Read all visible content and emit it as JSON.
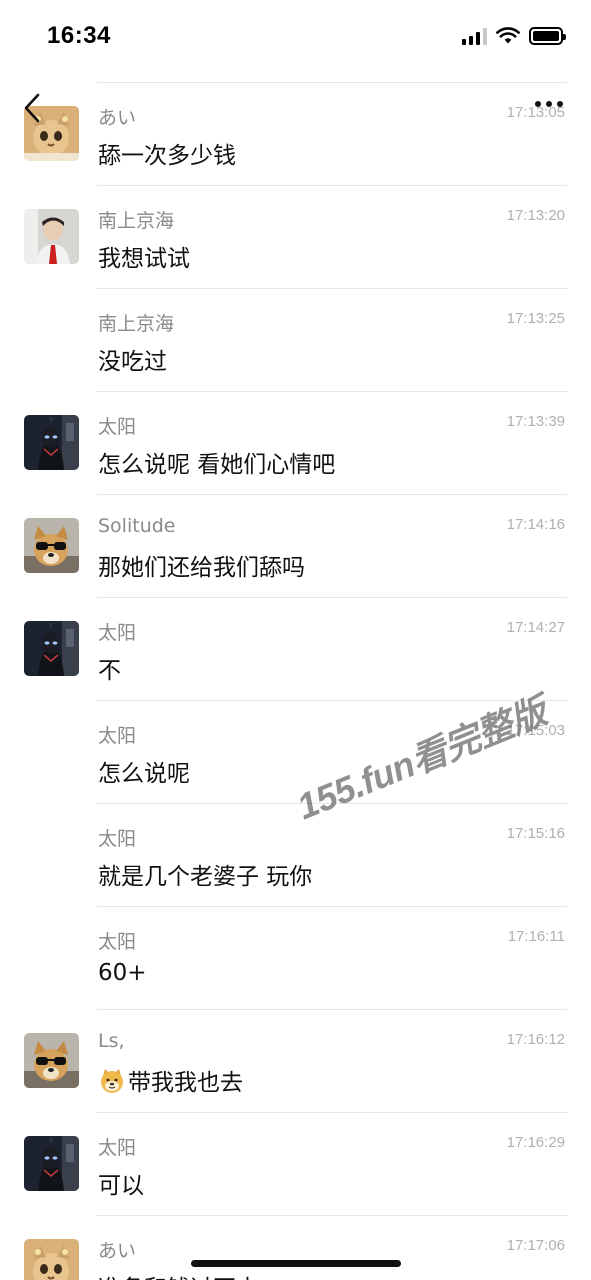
{
  "status_bar": {
    "time": "16:34",
    "icons": [
      "signal-icon",
      "wifi-icon",
      "battery-icon"
    ]
  },
  "header": {
    "back_icon": "chevron-left-icon",
    "more_icon": "more-dots-icon"
  },
  "messages": [
    {
      "sender": "あい",
      "time": "17:13:05",
      "text": "舔一次多少钱",
      "avatar": "cat-avatar"
    },
    {
      "sender": "南上京海",
      "time": "17:13:20",
      "text": "我想试试",
      "avatar": "person-avatar"
    },
    {
      "sender": "南上京海",
      "time": "17:13:25",
      "text": "没吃过",
      "avatar": null
    },
    {
      "sender": "太阳",
      "time": "17:13:39",
      "text": "怎么说呢 看她们心情吧",
      "avatar": "dark-hero-avatar"
    },
    {
      "sender": "Solitude",
      "time": "17:14:16",
      "text": "那她们还给我们舔吗",
      "avatar": "dog-sunglasses-avatar"
    },
    {
      "sender": "太阳",
      "time": "17:14:27",
      "text": "不",
      "avatar": "dark-hero-avatar"
    },
    {
      "sender": "太阳",
      "time": "17:15:03",
      "text": "怎么说呢",
      "avatar": null
    },
    {
      "sender": "太阳",
      "time": "17:15:16",
      "text": "就是几个老婆子 玩你",
      "avatar": null
    },
    {
      "sender": "太阳",
      "time": "17:16:11",
      "text": "60+",
      "avatar": null
    },
    {
      "sender": "Ls,",
      "time": "17:16:12",
      "text": "带我我也去",
      "avatar": "dog-sunglasses-avatar",
      "emoji": "doge-emoji-icon"
    },
    {
      "sender": "太阳",
      "time": "17:16:29",
      "text": "可以",
      "avatar": "dark-hero-avatar"
    },
    {
      "sender": "あい",
      "time": "17:17:06",
      "text": "准备和钱过不去",
      "avatar": "cat-avatar"
    }
  ],
  "watermark": "155.fun看完整版"
}
